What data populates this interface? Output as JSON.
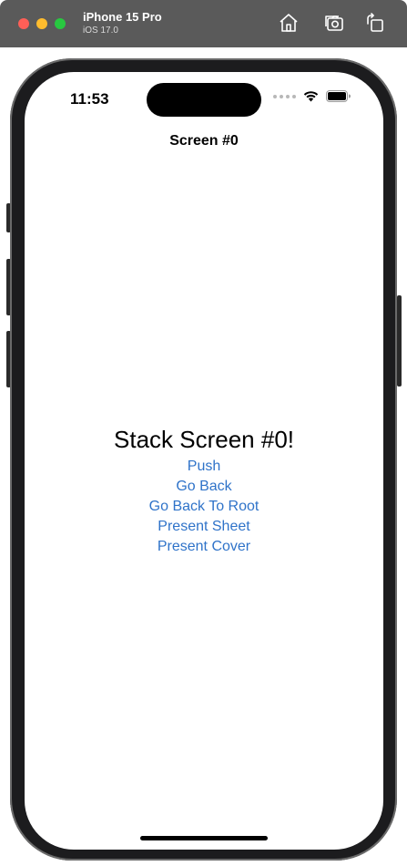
{
  "simulator": {
    "device_name": "iPhone 15 Pro",
    "os_version": "iOS 17.0",
    "toolbar_icons": [
      "home-icon",
      "screenshot-icon",
      "rotate-icon"
    ]
  },
  "status_bar": {
    "time": "11:53"
  },
  "nav": {
    "title": "Screen #0"
  },
  "main": {
    "heading": "Stack Screen #0!",
    "buttons": [
      {
        "label": "Push"
      },
      {
        "label": "Go Back"
      },
      {
        "label": "Go Back To Root"
      },
      {
        "label": "Present Sheet"
      },
      {
        "label": "Present Cover"
      }
    ]
  },
  "colors": {
    "accent": "#2f73c9",
    "titlebar": "#5a5a5a"
  }
}
